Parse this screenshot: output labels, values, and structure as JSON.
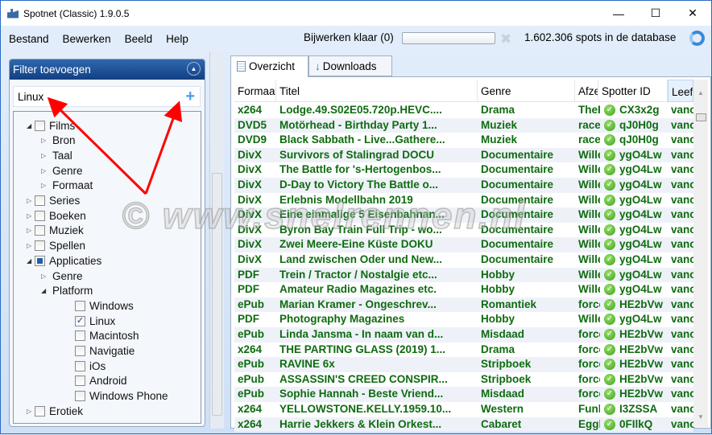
{
  "window": {
    "title": "Spotnet (Classic) 1.9.0.5",
    "minimize": "—",
    "maximize": "☐",
    "close": "✕"
  },
  "menu": [
    "Bestand",
    "Bewerken",
    "Beeld",
    "Help"
  ],
  "toolbar": {
    "status": "Bijwerken klaar (0)",
    "progress": 0,
    "spots": "1.602.306 spots in de database"
  },
  "filter": {
    "title": "Filter toevoegen",
    "input_value": "Linux",
    "tree": [
      {
        "label": "Films",
        "level": 0,
        "expand": "open",
        "check": "none"
      },
      {
        "label": "Bron",
        "level": 1,
        "expand": "closed"
      },
      {
        "label": "Taal",
        "level": 1,
        "expand": "closed"
      },
      {
        "label": "Genre",
        "level": 1,
        "expand": "closed"
      },
      {
        "label": "Formaat",
        "level": 1,
        "expand": "closed"
      },
      {
        "label": "Series",
        "level": 0,
        "expand": "closed",
        "check": "none"
      },
      {
        "label": "Boeken",
        "level": 0,
        "expand": "closed",
        "check": "none"
      },
      {
        "label": "Muziek",
        "level": 0,
        "expand": "closed",
        "check": "none"
      },
      {
        "label": "Spellen",
        "level": 0,
        "expand": "closed",
        "check": "none"
      },
      {
        "label": "Applicaties",
        "level": 0,
        "expand": "open",
        "check": "partial"
      },
      {
        "label": "Genre",
        "level": 1,
        "expand": "closed"
      },
      {
        "label": "Platform",
        "level": 1,
        "expand": "open"
      },
      {
        "label": "Windows",
        "level": 2,
        "check": "none"
      },
      {
        "label": "Linux",
        "level": 2,
        "check": "checked"
      },
      {
        "label": "Macintosh",
        "level": 2,
        "check": "none"
      },
      {
        "label": "Navigatie",
        "level": 2,
        "check": "none"
      },
      {
        "label": "iOs",
        "level": 2,
        "check": "none"
      },
      {
        "label": "Android",
        "level": 2,
        "check": "none"
      },
      {
        "label": "Windows Phone",
        "level": 2,
        "check": "none"
      },
      {
        "label": "Erotiek",
        "level": 0,
        "expand": "closed",
        "check": "none"
      }
    ]
  },
  "tabs": [
    {
      "label": "Overzicht",
      "icon": "list-icon",
      "active": true
    },
    {
      "label": "Downloads",
      "icon": "download-arrow-icon",
      "active": false
    }
  ],
  "grid": {
    "columns": [
      "Formaat",
      "Titel",
      "Genre",
      "Afzender",
      "Spotter ID",
      "Leeftijd"
    ],
    "text_color": "#0f6b10",
    "rows": [
      [
        "x264",
        "Lodge.49.S02E05.720p.HEVC....",
        "Drama",
        "TheF",
        "CX3x2g",
        "vanc"
      ],
      [
        "DVD5",
        "Motörhead - Birthday Party 1...",
        "Muziek",
        "racel",
        "qJ0H0g",
        "vanc"
      ],
      [
        "DVD9",
        "Black Sabbath - Live...Gathere...",
        "Muziek",
        "racel",
        "qJ0H0g",
        "vanc"
      ],
      [
        "DivX",
        "Survivors of Stalingrad DOCU",
        "Documentaire",
        "Wille",
        "ygO4Lw",
        "vanc"
      ],
      [
        "DivX",
        "The Battle for 's-Hertogenbos...",
        "Documentaire",
        "Wille",
        "ygO4Lw",
        "vanc"
      ],
      [
        "DivX",
        "D-Day to Victory The Battle o...",
        "Documentaire",
        "Wille",
        "ygO4Lw",
        "vanc"
      ],
      [
        "DivX",
        "Erlebnis Modellbahn 2019",
        "Documentaire",
        "Wille",
        "ygO4Lw",
        "vanc"
      ],
      [
        "DivX",
        "Eine einmalige 5 Eisenbahnan...",
        "Documentaire",
        "Wille",
        "ygO4Lw",
        "vanc"
      ],
      [
        "DivX",
        "Byron Bay Train Full Trip - wo...",
        "Documentaire",
        "Wille",
        "ygO4Lw",
        "vanc"
      ],
      [
        "DivX",
        "Zwei Meere-Eine Küste DOKU",
        "Documentaire",
        "Wille",
        "ygO4Lw",
        "vanc"
      ],
      [
        "DivX",
        "Land zwischen Oder und New...",
        "Documentaire",
        "Wille",
        "ygO4Lw",
        "vanc"
      ],
      [
        "PDF",
        "Trein / Tractor / Nostalgie etc...",
        "Hobby",
        "Wille",
        "ygO4Lw",
        "vanc"
      ],
      [
        "PDF",
        "Amateur Radio Magazines etc.",
        "Hobby",
        "Wille",
        "ygO4Lw",
        "vanc"
      ],
      [
        "ePub",
        "Marian Kramer - Ongeschrev...",
        "Romantiek",
        "force",
        "HE2bVw",
        "vanc"
      ],
      [
        "PDF",
        "Photography Magazines",
        "Hobby",
        "Wille",
        "ygO4Lw",
        "vanc"
      ],
      [
        "ePub",
        "Linda Jansma - In naam van d...",
        "Misdaad",
        "force",
        "HE2bVw",
        "vanc"
      ],
      [
        "x264",
        "THE PARTING GLASS (2019) 1...",
        "Drama",
        "force",
        "HE2bVw",
        "vanc"
      ],
      [
        "ePub",
        "RAVINE 6x",
        "Stripboek",
        "force",
        "HE2bVw",
        "vanc"
      ],
      [
        "ePub",
        "ASSASSIN'S CREED CONSPIR...",
        "Stripboek",
        "force",
        "HE2bVw",
        "vanc"
      ],
      [
        "ePub",
        "Sophie Hannah - Beste Vriend...",
        "Misdaad",
        "force",
        "HE2bVw",
        "vanc"
      ],
      [
        "x264",
        "YELLOWSTONE.KELLY.1959.10...",
        "Western",
        "Funk",
        "I3ZSSA",
        "vanc"
      ],
      [
        "x264",
        "Harrie Jekkers & Klein Orkest...",
        "Cabaret",
        "Eggl",
        "0FIlkQ",
        "vanc"
      ]
    ]
  },
  "watermark": "© www.snelrennen.nl"
}
